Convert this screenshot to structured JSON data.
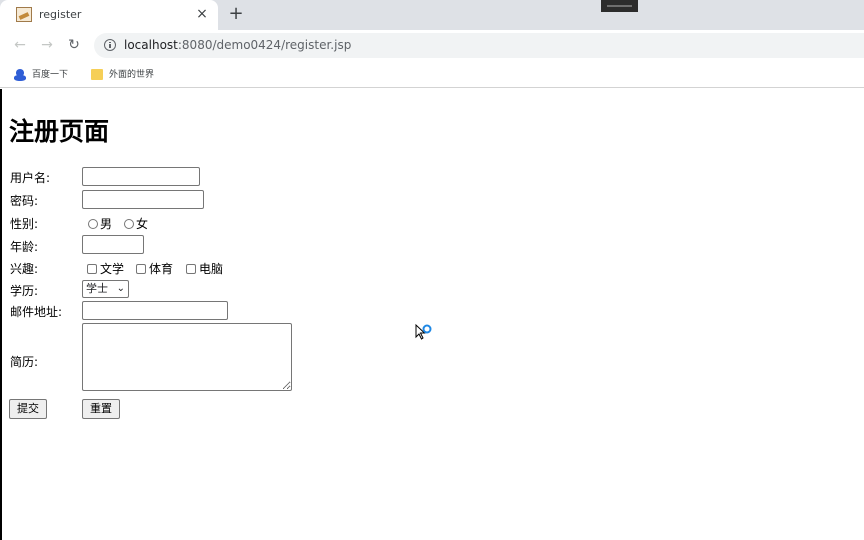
{
  "browser": {
    "tab_title": "register",
    "tab_close": "×",
    "new_tab": "+",
    "url_host": "localhost",
    "url_rest": ":8080/demo0424/register.jsp",
    "bookmarks": [
      {
        "label": "百度一下",
        "icon": "baidu-icon"
      },
      {
        "label": "外面的世界",
        "icon": "folder-icon"
      }
    ]
  },
  "form": {
    "title": "注册页面",
    "username_label": "用户名:",
    "username_value": "",
    "password_label": "密码:",
    "password_value": "",
    "gender_label": "性别:",
    "gender_options": [
      "男",
      "女"
    ],
    "age_label": "年龄:",
    "age_value": "",
    "hobby_label": "兴趣:",
    "hobby_options": [
      "文学",
      "体育",
      "电脑"
    ],
    "education_label": "学历:",
    "education_selected": "学士",
    "email_label": "邮件地址:",
    "email_value": "",
    "resume_label": "简历:",
    "submit_label": "提交",
    "reset_label": "重置"
  }
}
